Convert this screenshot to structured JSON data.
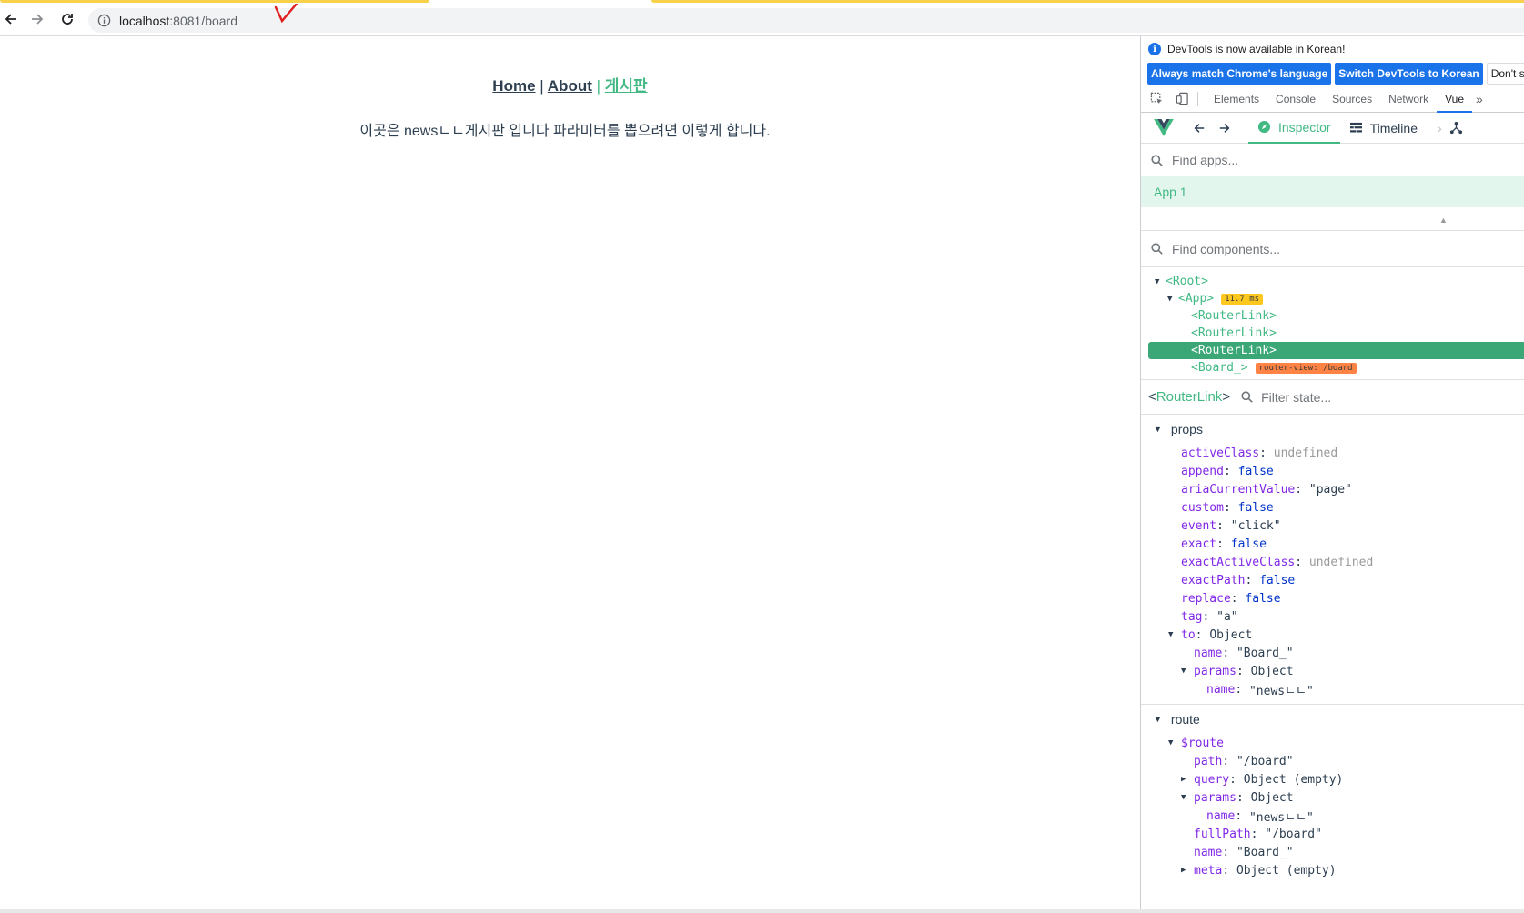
{
  "browser": {
    "url_host": "localhost",
    "url_rest": ":8081/board"
  },
  "page": {
    "nav": {
      "home": "Home",
      "about": "About",
      "board": "게시판",
      "separator": "|"
    },
    "content_text": "이곳은 newsㄴㄴ게시판 입니다 파라미터를 뽑으려면 이렇게 합니다."
  },
  "devtools": {
    "banner": "DevTools is now available in Korean!",
    "lang_buttons": {
      "match": "Always match Chrome's language",
      "switch": "Switch DevTools to Korean",
      "dont": "Don't show"
    },
    "tabs": [
      "Elements",
      "Console",
      "Sources",
      "Network",
      "Vue"
    ],
    "active_tab": "Vue",
    "vue": {
      "inspector_label": "Inspector",
      "timeline_label": "Timeline",
      "find_apps_placeholder": "Find apps...",
      "app_name": "App 1",
      "find_components_placeholder": "Find components...",
      "tree": {
        "root": "<Root>",
        "app": "<App>",
        "app_time": "11.7 ms",
        "link1": "<RouterLink>",
        "link2": "<RouterLink>",
        "link3": "<RouterLink>",
        "board": "<Board_>",
        "board_badge": "router-view: /board"
      },
      "selected": {
        "open": "<",
        "name": "RouterLink",
        "close": ">",
        "filter_placeholder": "Filter state..."
      },
      "props_title": "props",
      "props": {
        "activeClass": "undefined",
        "append": "false",
        "ariaCurrentValue": "\"page\"",
        "custom": "false",
        "event": "\"click\"",
        "exact": "false",
        "exactActiveClass": "undefined",
        "exactPath": "false",
        "replace": "false",
        "tag": "\"a\"",
        "to": "Object",
        "to_name": "\"Board_\"",
        "to_params": "Object",
        "to_params_name": "\"newsㄴㄴ\""
      },
      "route_title": "route",
      "route": {
        "route_key": "$route",
        "path": "\"/board\"",
        "query": "Object (empty)",
        "params": "Object",
        "params_name": "\"newsㄴㄴ\"",
        "fullPath": "\"/board\"",
        "name": "\"Board_\"",
        "meta": "Object (empty)"
      }
    }
  },
  "colors": {
    "vue_green": "#42b983",
    "link_dark": "#2c3e50",
    "chrome_blue": "#1a73e8",
    "tab_yellow": "#f9d04a"
  }
}
